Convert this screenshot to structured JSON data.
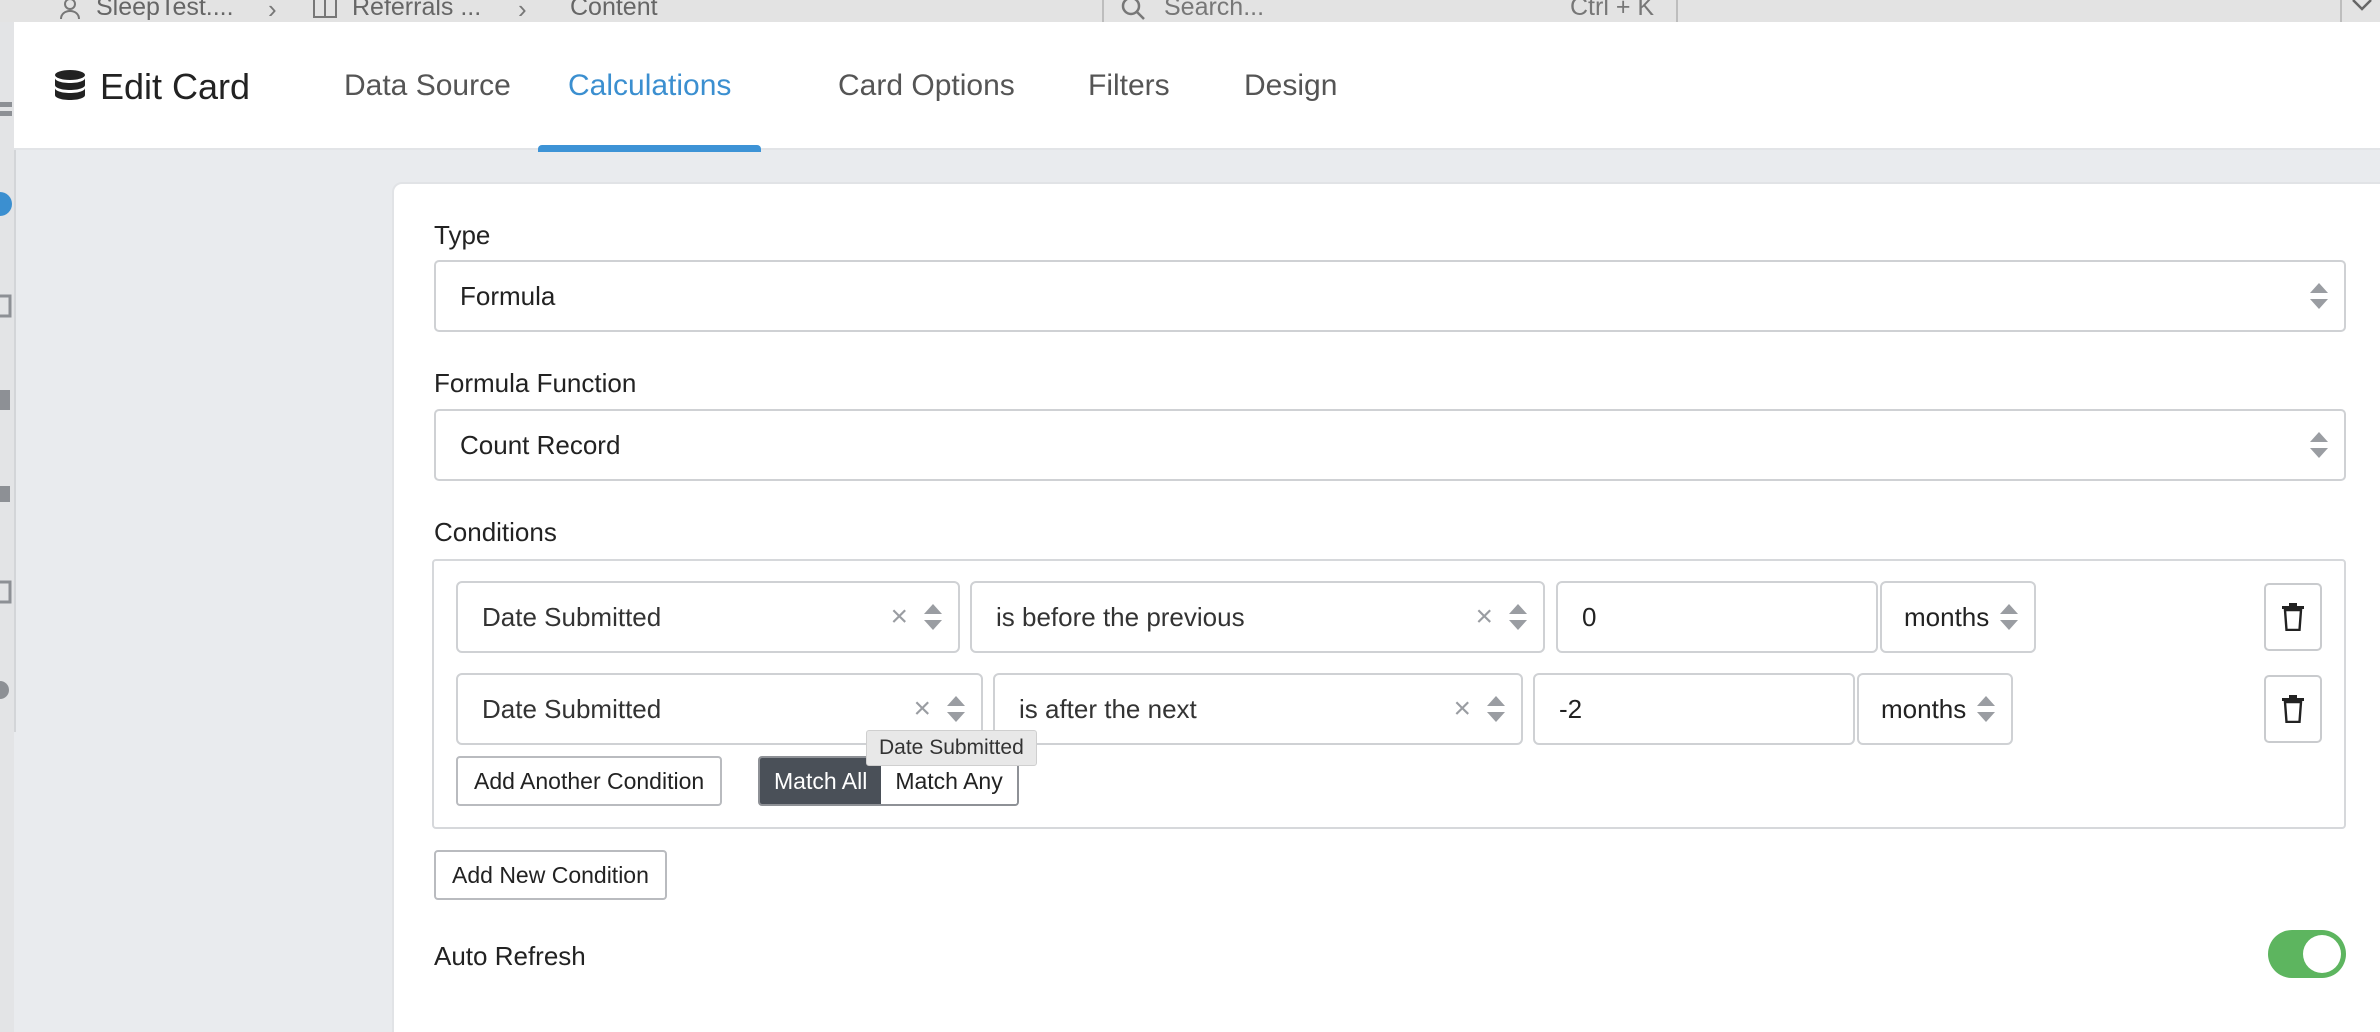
{
  "breadcrumb": {
    "items": [
      "SleepTest....",
      "Referrals ...",
      "Content"
    ],
    "search_placeholder": "Search...",
    "shortcut": "Ctrl + K"
  },
  "header": {
    "title": "Edit Card",
    "tabs": [
      {
        "label": "Data Source",
        "active": false
      },
      {
        "label": "Calculations",
        "active": true
      },
      {
        "label": "Card Options",
        "active": false
      },
      {
        "label": "Filters",
        "active": false
      },
      {
        "label": "Design",
        "active": false
      }
    ]
  },
  "form": {
    "type_label": "Type",
    "type_value": "Formula",
    "function_label": "Formula Function",
    "function_value": "Count Record",
    "conditions_label": "Conditions",
    "conditions": [
      {
        "field": "Date Submitted",
        "operator": "is before the previous",
        "value": "0",
        "unit": "months"
      },
      {
        "field": "Date Submitted",
        "operator": "is after the next",
        "value": "-2",
        "unit": "months"
      }
    ],
    "add_another_condition": "Add Another Condition",
    "match_all": "Match All",
    "match_any": "Match Any",
    "match_mode": "all",
    "tooltip": "Date Submitted",
    "add_new_condition": "Add New Condition",
    "auto_refresh_label": "Auto Refresh",
    "auto_refresh_on": true
  },
  "colors": {
    "accent": "#3b8fd0",
    "toggle_on": "#5db55f",
    "segment_active": "#4a5058"
  }
}
